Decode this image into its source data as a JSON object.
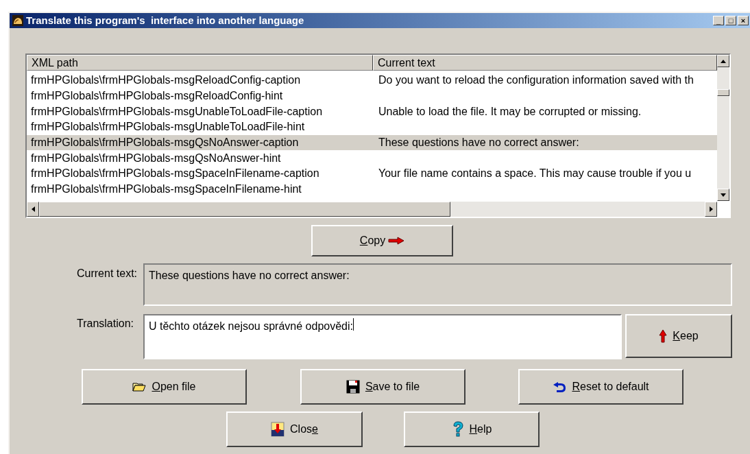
{
  "window": {
    "title": "Translate this program's  interface into another language",
    "controls": [
      "_",
      "□",
      "×"
    ]
  },
  "table": {
    "columns": [
      "XML path",
      "Current text"
    ],
    "rows": [
      {
        "path": "frmHPGlobals\\frmHPGlobals-msgReloadConfig-caption",
        "text": "Do you want to reload the configuration information saved with th",
        "selected": false
      },
      {
        "path": "frmHPGlobals\\frmHPGlobals-msgReloadConfig-hint",
        "selected": false
      },
      {
        "path": "frmHPGlobals\\frmHPGlobals-msgUnableToLoadFile-caption",
        "text": "Unable to load the file. It may be corrupted or missing.",
        "selected": false
      },
      {
        "path": "frmHPGlobals\\frmHPGlobals-msgUnableToLoadFile-hint",
        "selected": false
      },
      {
        "path": "frmHPGlobals\\frmHPGlobals-msgQsNoAnswer-caption",
        "text": "These questions have no correct answer:",
        "selected": true
      },
      {
        "path": "frmHPGlobals\\frmHPGlobals-msgQsNoAnswer-hint",
        "selected": false
      },
      {
        "path": "frmHPGlobals\\frmHPGlobals-msgSpaceInFilename-caption",
        "text": "Your file name contains a space. This may cause trouble if you u",
        "selected": false
      },
      {
        "path": "frmHPGlobals\\frmHPGlobals-msgSpaceInFilename-hint",
        "selected": false
      }
    ]
  },
  "copy_button": {
    "key": "C",
    "after": "opy"
  },
  "current_text": {
    "label": "Current text:",
    "value": "These questions have no correct answer:"
  },
  "translation": {
    "label": "Translation:",
    "value": "U těchto otázek nejsou správné odpovědi:"
  },
  "keep_button": {
    "key": "K",
    "after": "eep"
  },
  "buttons": [
    {
      "kind": "open",
      "key": "O",
      "after": "pen file"
    },
    {
      "kind": "save",
      "key": "S",
      "after": "ave to file"
    },
    {
      "kind": "reset",
      "key": "R",
      "after": "eset to default"
    },
    {
      "kind": "close",
      "before": "Clos",
      "key": "e"
    },
    {
      "kind": "help",
      "key": "H",
      "after": "elp"
    }
  ]
}
